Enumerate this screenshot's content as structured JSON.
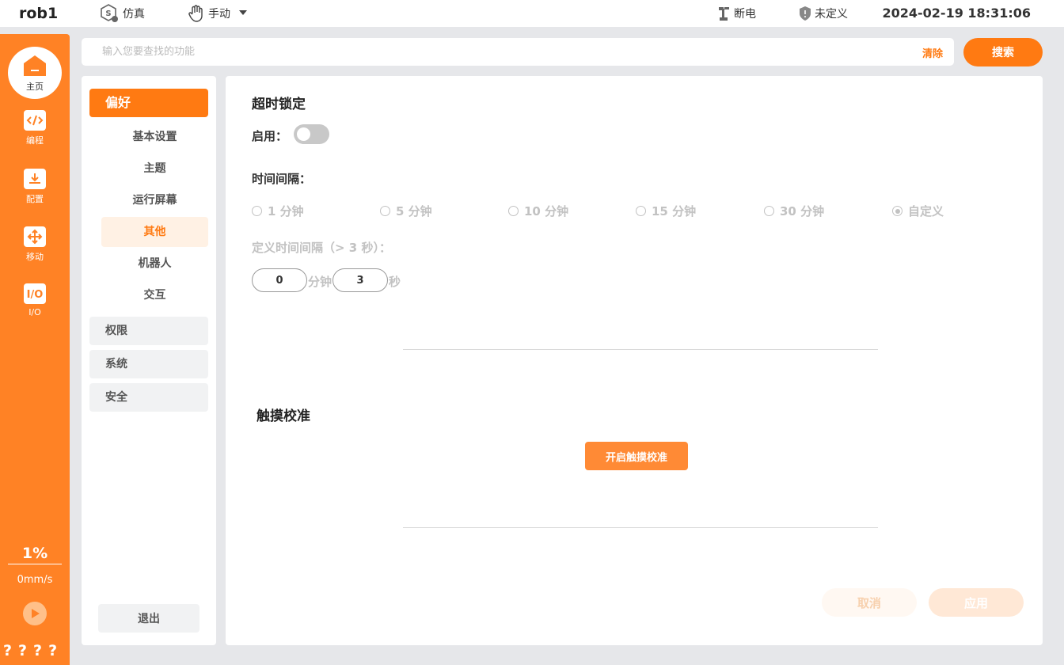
{
  "topbar": {
    "robot_name": "rob1",
    "mode_label": "仿真",
    "control_label": "手动",
    "power_label": "断电",
    "safety_label": "未定义",
    "datetime": "2024-02-19 18:31:06"
  },
  "rail": {
    "items": [
      {
        "label": "主页",
        "icon": "home-icon"
      },
      {
        "label": "编程",
        "icon": "code-icon"
      },
      {
        "label": "配置",
        "icon": "config-download-icon"
      },
      {
        "label": "移动",
        "icon": "move-arrows-icon"
      },
      {
        "label": "I/O",
        "icon": "io-icon"
      }
    ],
    "speed_percent": "1%",
    "speed_value": "0mm/s",
    "status_marks": "????"
  },
  "search": {
    "placeholder": "输入您要查找的功能",
    "clear_label": "清除",
    "button_label": "搜索"
  },
  "menu": {
    "active_category": "偏好",
    "sub_items": [
      "基本设置",
      "主题",
      "运行屏幕",
      "其他",
      "机器人",
      "交互"
    ],
    "active_sub": "其他",
    "categories": [
      "权限",
      "系统",
      "安全"
    ],
    "exit_label": "退出"
  },
  "timeout_lock": {
    "title": "超时锁定",
    "enable_label": "启用：",
    "enabled": false,
    "interval_label": "时间间隔：",
    "options": [
      "1 分钟",
      "5 分钟",
      "10 分钟",
      "15 分钟",
      "30 分钟",
      "自定义"
    ],
    "selected_option": "自定义",
    "custom_label": "定义时间间隔（> 3 秒）：",
    "minutes_value": "0",
    "minutes_unit": "分钟",
    "seconds_value": "3",
    "seconds_unit": "秒"
  },
  "touch_calibration": {
    "title": "触摸校准",
    "button_label": "开启触摸校准"
  },
  "footer": {
    "cancel_label": "取消",
    "apply_label": "应用"
  },
  "colors": {
    "accent": "#ff7a12",
    "rail": "#ff8225",
    "disabled_text": "#c2c2c2"
  }
}
